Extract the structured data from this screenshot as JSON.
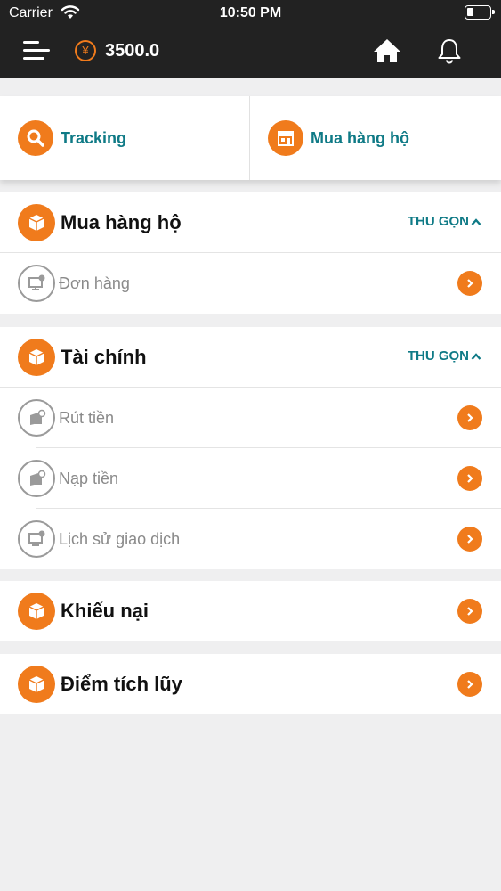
{
  "status_bar": {
    "carrier": "Carrier",
    "time": "10:50 PM"
  },
  "header": {
    "currency_symbol": "¥",
    "balance": "3500.0",
    "icons": [
      "menu-icon",
      "yen-coin-icon",
      "home-icon",
      "bell-icon"
    ]
  },
  "quick_actions": [
    {
      "label": "Tracking",
      "icon": "search-icon"
    },
    {
      "label": "Mua hàng hộ",
      "icon": "store-icon"
    }
  ],
  "sections": {
    "purchase": {
      "title": "Mua hàng hộ",
      "collapse_label": "THU GỌN",
      "icon": "box-icon",
      "items": [
        {
          "label": "Đơn hàng",
          "icon": "monitor-icon"
        }
      ]
    },
    "finance": {
      "title": "Tài chính",
      "collapse_label": "THU GỌN",
      "icon": "box-icon",
      "items": [
        {
          "label": "Rút tiền",
          "icon": "wallet-icon"
        },
        {
          "label": "Nạp tiền",
          "icon": "wallet-icon"
        },
        {
          "label": "Lịch sử giao dịch",
          "icon": "monitor-icon"
        }
      ]
    },
    "complaints": {
      "title": "Khiếu nại",
      "icon": "box-icon"
    },
    "points": {
      "title": "Điểm tích lũy",
      "icon": "box-icon"
    }
  },
  "colors": {
    "accent": "#f07b1c",
    "teal": "#0f7a86",
    "header_bg": "#222222",
    "page_bg": "#efeff0"
  }
}
